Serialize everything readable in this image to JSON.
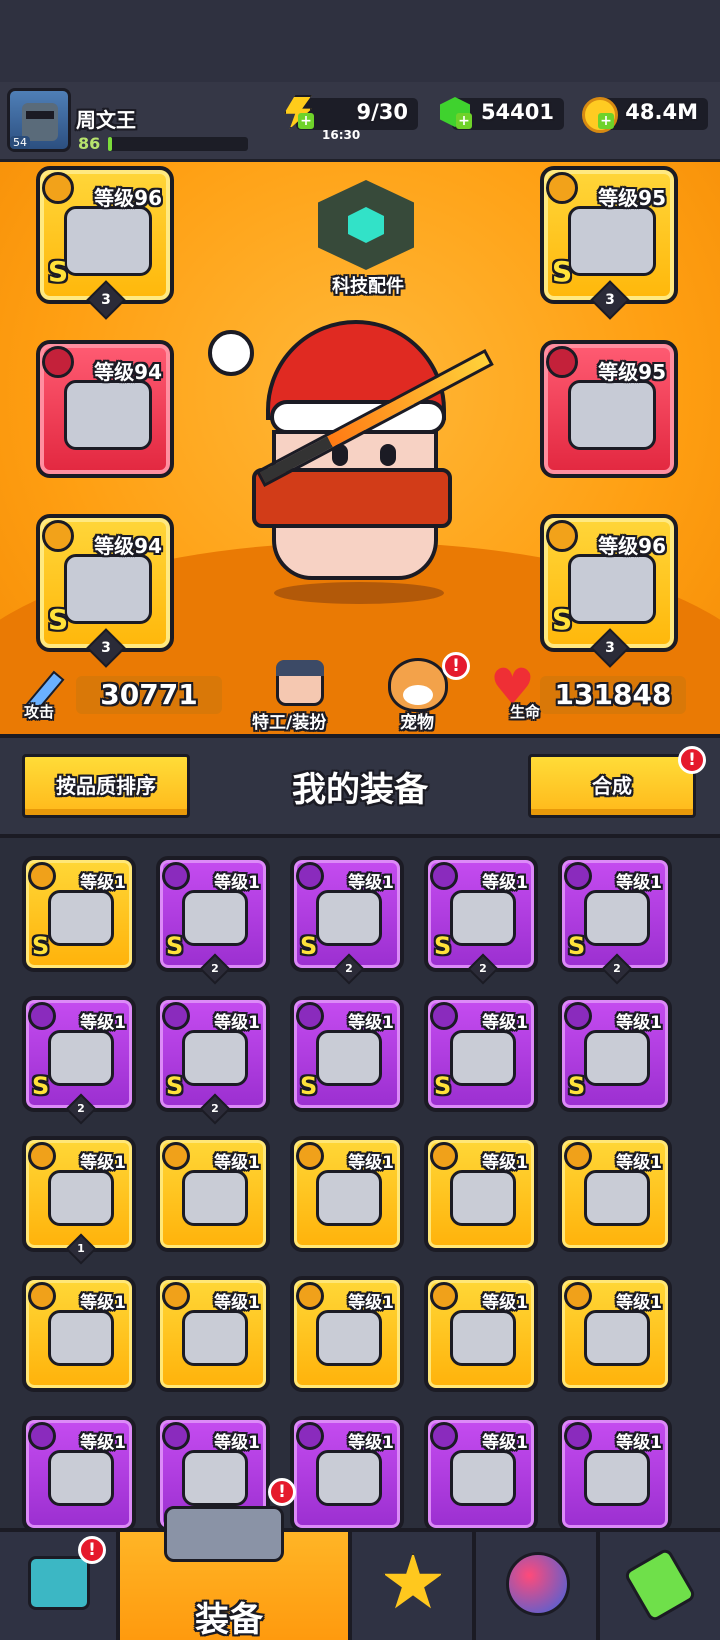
{
  "player": {
    "name": "周文王",
    "level": "86",
    "avatar_level": "54",
    "xp_fraction": 0.03
  },
  "resources": {
    "energy": "9/30",
    "energy_timer": "16:30",
    "gems": "54401",
    "coins": "48.4M"
  },
  "hero": {
    "tech_label": "科技配件",
    "slots": [
      {
        "id": "weapon",
        "lv": "等级96",
        "grade": "S",
        "stars": "3",
        "rarity": "gold",
        "icon": "gun-icon"
      },
      {
        "id": "armor",
        "lv": "等级95",
        "grade": "S",
        "stars": "3",
        "rarity": "gold",
        "icon": "shirt-icon"
      },
      {
        "id": "necklace",
        "lv": "等级94",
        "grade": "",
        "stars": "",
        "rarity": "red",
        "icon": "necklace-icon"
      },
      {
        "id": "belt",
        "lv": "等级95",
        "grade": "",
        "stars": "",
        "rarity": "red",
        "icon": "belt-icon"
      },
      {
        "id": "glove",
        "lv": "等级94",
        "grade": "S",
        "stars": "3",
        "rarity": "gold",
        "icon": "glove-icon"
      },
      {
        "id": "boots",
        "lv": "等级96",
        "grade": "S",
        "stars": "3",
        "rarity": "gold",
        "icon": "boot-icon"
      }
    ],
    "attack_label": "攻击",
    "attack": "30771",
    "agent_label": "特工/装扮",
    "pet_label": "宠物",
    "hp_label": "生命",
    "hp": "131848"
  },
  "equipment": {
    "title": "我的装备",
    "sort_label": "按品质排序",
    "merge_label": "合成",
    "alert": "!",
    "items": [
      {
        "lv": "等级1",
        "grade": "S",
        "stars": "",
        "rarity": "gold",
        "icon": "belt-icon"
      },
      {
        "lv": "等级1",
        "grade": "S",
        "stars": "2",
        "rarity": "purple",
        "icon": "gun-icon"
      },
      {
        "lv": "等级1",
        "grade": "S",
        "stars": "2",
        "rarity": "purple",
        "icon": "shirt-icon"
      },
      {
        "lv": "等级1",
        "grade": "S",
        "stars": "2",
        "rarity": "purple",
        "icon": "necklace-icon"
      },
      {
        "lv": "等级1",
        "grade": "S",
        "stars": "2",
        "rarity": "purple",
        "icon": "glove-icon"
      },
      {
        "lv": "等级1",
        "grade": "S",
        "stars": "2",
        "rarity": "purple",
        "icon": "glove-icon"
      },
      {
        "lv": "等级1",
        "grade": "S",
        "stars": "2",
        "rarity": "purple",
        "icon": "boot-icon"
      },
      {
        "lv": "等级1",
        "grade": "S",
        "stars": "",
        "rarity": "purple",
        "icon": "gun-icon"
      },
      {
        "lv": "等级1",
        "grade": "S",
        "stars": "",
        "rarity": "purple",
        "icon": "shirt-icon"
      },
      {
        "lv": "等级1",
        "grade": "S",
        "stars": "",
        "rarity": "purple",
        "icon": "necklace-icon"
      },
      {
        "lv": "等级1",
        "grade": "",
        "stars": "1",
        "rarity": "gold",
        "icon": "gun-icon"
      },
      {
        "lv": "等级1",
        "grade": "",
        "stars": "",
        "rarity": "gold",
        "icon": "gun-icon"
      },
      {
        "lv": "等级1",
        "grade": "",
        "stars": "",
        "rarity": "gold",
        "icon": "shirt-icon"
      },
      {
        "lv": "等级1",
        "grade": "",
        "stars": "",
        "rarity": "gold",
        "icon": "shirt-icon"
      },
      {
        "lv": "等级1",
        "grade": "",
        "stars": "",
        "rarity": "gold",
        "icon": "glove-icon"
      },
      {
        "lv": "等级1",
        "grade": "",
        "stars": "",
        "rarity": "gold",
        "icon": "glove-icon"
      },
      {
        "lv": "等级1",
        "grade": "",
        "stars": "",
        "rarity": "gold",
        "icon": "glove-icon"
      },
      {
        "lv": "等级1",
        "grade": "",
        "stars": "",
        "rarity": "gold",
        "icon": "boot-icon"
      },
      {
        "lv": "等级1",
        "grade": "",
        "stars": "",
        "rarity": "gold",
        "icon": "boot-icon"
      },
      {
        "lv": "等级1",
        "grade": "",
        "stars": "",
        "rarity": "gold",
        "icon": "boot-icon"
      },
      {
        "lv": "等级1",
        "grade": "",
        "stars": "",
        "rarity": "purple",
        "icon": "gun-icon"
      },
      {
        "lv": "等级1",
        "grade": "",
        "stars": "",
        "rarity": "purple",
        "icon": "shirt-icon"
      },
      {
        "lv": "等级1",
        "grade": "",
        "stars": "",
        "rarity": "purple",
        "icon": "necklace-icon"
      },
      {
        "lv": "等级1",
        "grade": "",
        "stars": "",
        "rarity": "purple",
        "icon": "belt-icon"
      },
      {
        "lv": "等级1",
        "grade": "",
        "stars": "",
        "rarity": "purple",
        "icon": "gun-icon"
      }
    ]
  },
  "nav": {
    "equip_label": "装备",
    "alert": "!"
  }
}
